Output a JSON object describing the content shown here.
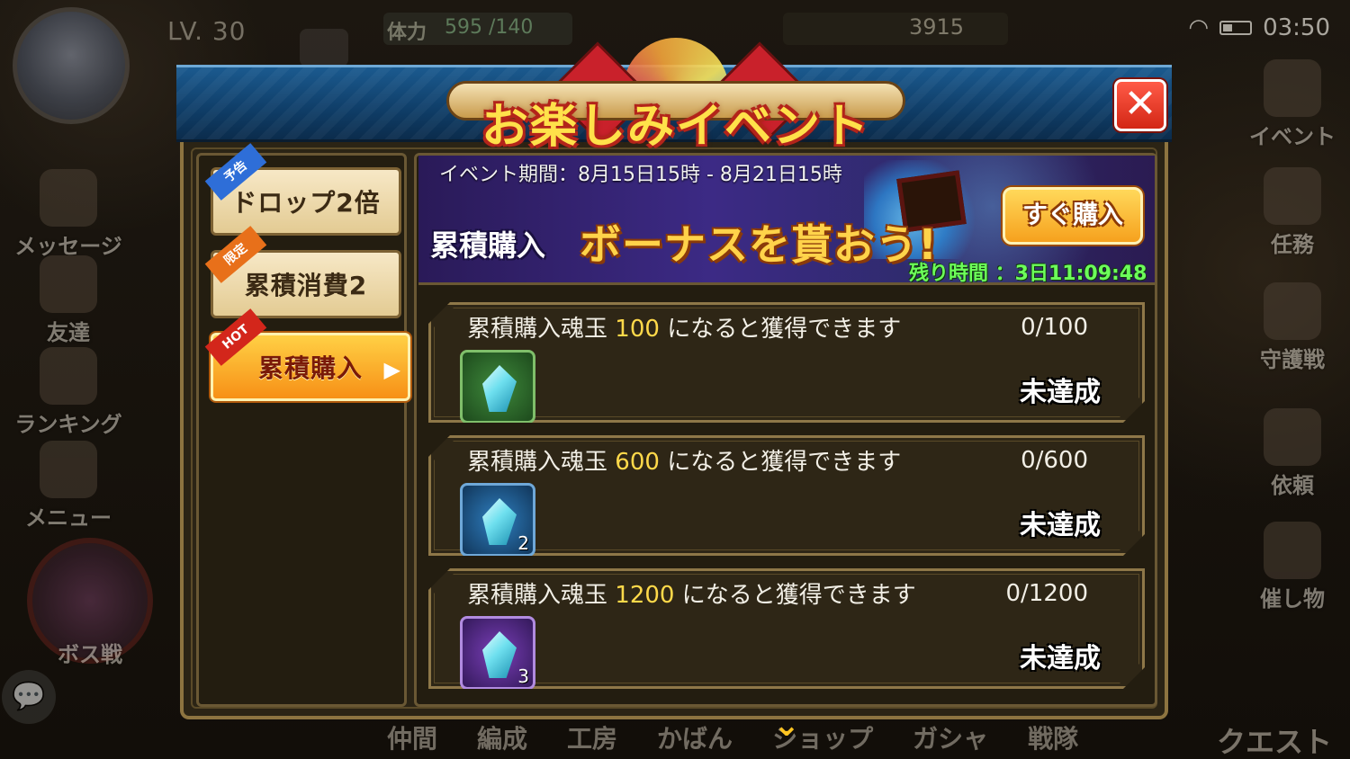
{
  "hud": {
    "level": "LV. 30",
    "stamina_label": "体力",
    "stamina_value": "595 /140",
    "gems_value": "3915",
    "time": "03:50"
  },
  "side_menu_left": [
    {
      "label": "メッセージ",
      "icon": "message-icon"
    },
    {
      "label": "友達",
      "icon": "friends-icon"
    },
    {
      "label": "ランキング",
      "icon": "trophy-icon"
    },
    {
      "label": "メニュー",
      "icon": "menu-icon"
    },
    {
      "label": "ボス戦",
      "icon": "boss-icon"
    }
  ],
  "side_menu_right": [
    {
      "label": "イベント",
      "icon": "event-icon"
    },
    {
      "label": "任務",
      "icon": "mission-icon"
    },
    {
      "label": "守護戦",
      "icon": "guardian-icon"
    },
    {
      "label": "依頼",
      "icon": "request-icon"
    },
    {
      "label": "催し物",
      "icon": "festival-icon"
    }
  ],
  "bottom_nav": [
    "仲間",
    "編成",
    "工房",
    "かばん",
    "ショップ",
    "ガシャ",
    "戦隊"
  ],
  "quest_label": "クエスト",
  "modal": {
    "title": "お楽しみイベント",
    "close_label": "✕",
    "tabs": [
      {
        "label": "ドロップ2倍",
        "ribbon": "予告",
        "ribbon_color": "#2e6ed8",
        "active": false
      },
      {
        "label": "累積消費2",
        "ribbon": "限定",
        "ribbon_color": "#e8701a",
        "active": false
      },
      {
        "label": "累積購入",
        "ribbon": "HOT",
        "ribbon_color": "#d3261b",
        "active": true
      }
    ],
    "banner": {
      "period": "イベント期間：8月15日15時 - 8月21日15時",
      "left_text": "累積購入",
      "main_text": "ボーナスを貰おう!",
      "buy_button": "すぐ購入",
      "remaining": "残り時間 ：3日11:09:48"
    },
    "rewards": [
      {
        "prefix": "累積購入魂玉",
        "amount": "100",
        "suffix": "になると獲得できます",
        "progress": "0/100",
        "status": "未達成",
        "item_color": "green",
        "item_count": ""
      },
      {
        "prefix": "累積購入魂玉",
        "amount": "600",
        "suffix": "になると獲得できます",
        "progress": "0/600",
        "status": "未達成",
        "item_color": "blue",
        "item_count": "2"
      },
      {
        "prefix": "累積購入魂玉",
        "amount": "1200",
        "suffix": "になると獲得できます",
        "progress": "0/1200",
        "status": "未達成",
        "item_color": "purple",
        "item_count": "3"
      }
    ]
  }
}
